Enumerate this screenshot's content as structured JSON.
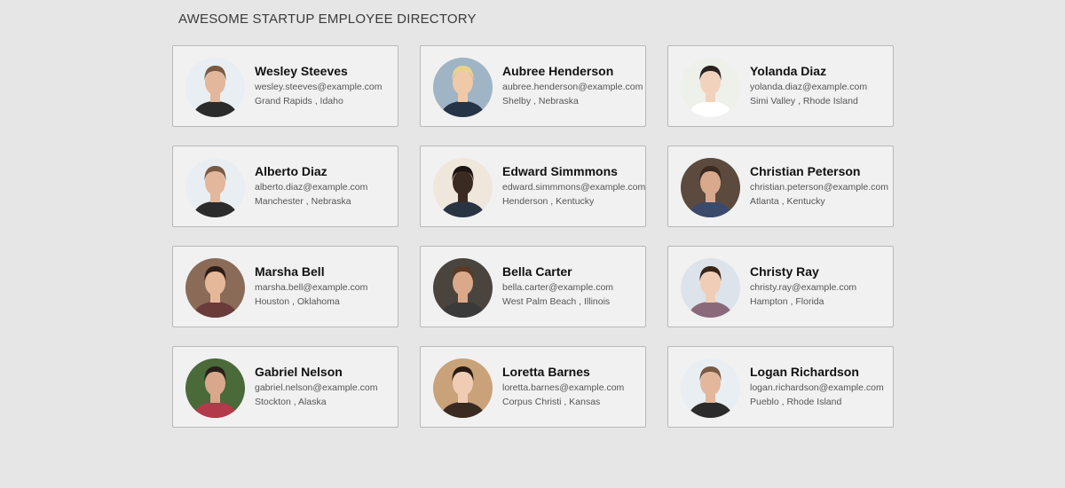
{
  "page": {
    "title": "AWESOME STARTUP EMPLOYEE DIRECTORY"
  },
  "employees": [
    {
      "name": "Wesley Steeves",
      "email": "wesley.steeves@example.com",
      "location": "Grand Rapids , Idaho",
      "photo": {
        "bg": "#e9eef2",
        "skin": "#e2b79b",
        "hair": "#7a5a45",
        "shirt": "#2b2b2b"
      }
    },
    {
      "name": "Aubree Henderson",
      "email": "aubree.henderson@example.com",
      "location": "Shelby , Nebraska",
      "photo": {
        "bg": "#9fb4c4",
        "skin": "#efc9a8",
        "hair": "#e8d38c",
        "shirt": "#253447"
      }
    },
    {
      "name": "Yolanda Diaz",
      "email": "yolanda.diaz@example.com",
      "location": "Simi Valley , Rhode Island",
      "photo": {
        "bg": "#eef0ea",
        "skin": "#f1d2bd",
        "hair": "#2a2320",
        "shirt": "#ffffff"
      }
    },
    {
      "name": "Alberto Diaz",
      "email": "alberto.diaz@example.com",
      "location": "Manchester , Nebraska",
      "photo": {
        "bg": "#e9eef2",
        "skin": "#e2b79b",
        "hair": "#7a5a45",
        "shirt": "#2b2b2b"
      }
    },
    {
      "name": "Edward Simmmons",
      "email": "edward.simmmons@example.com",
      "location": "Henderson , Kentucky",
      "photo": {
        "bg": "#efe7dc",
        "skin": "#3b2a22",
        "hair": "#1b1411",
        "shirt": "#2a3342"
      }
    },
    {
      "name": "Christian Peterson",
      "email": "christian.peterson@example.com",
      "location": "Atlanta , Kentucky",
      "photo": {
        "bg": "#5b4a3d",
        "skin": "#d8a98c",
        "hair": "#3a2a20",
        "shirt": "#3b4a6b"
      }
    },
    {
      "name": "Marsha Bell",
      "email": "marsha.bell@example.com",
      "location": "Houston , Oklahoma",
      "photo": {
        "bg": "#8a6b58",
        "skin": "#e5b89a",
        "hair": "#2e1d16",
        "shirt": "#6a3b38"
      }
    },
    {
      "name": "Bella Carter",
      "email": "bella.carter@example.com",
      "location": "West Palm Beach , Illinois",
      "photo": {
        "bg": "#4a443f",
        "skin": "#d9a98a",
        "hair": "#5a3a26",
        "shirt": "#3a3a3a"
      }
    },
    {
      "name": "Christy Ray",
      "email": "christy.ray@example.com",
      "location": "Hampton , Florida",
      "photo": {
        "bg": "#dde3ea",
        "skin": "#efcdb6",
        "hair": "#3a251a",
        "shirt": "#8a6a7a"
      }
    },
    {
      "name": "Gabriel Nelson",
      "email": "gabriel.nelson@example.com",
      "location": "Stockton , Alaska",
      "photo": {
        "bg": "#4a6a3a",
        "skin": "#d9a88c",
        "hair": "#2a1f18",
        "shirt": "#b23a4a"
      }
    },
    {
      "name": "Loretta Barnes",
      "email": "loretta.barnes@example.com",
      "location": "Corpus Christi , Kansas",
      "photo": {
        "bg": "#c9a27a",
        "skin": "#f0ccb5",
        "hair": "#2a1a14",
        "shirt": "#3a2a22"
      }
    },
    {
      "name": "Logan Richardson",
      "email": "logan.richardson@example.com",
      "location": "Pueblo , Rhode Island",
      "photo": {
        "bg": "#e9eef2",
        "skin": "#e2b79b",
        "hair": "#7a5a45",
        "shirt": "#2b2b2b"
      }
    }
  ]
}
